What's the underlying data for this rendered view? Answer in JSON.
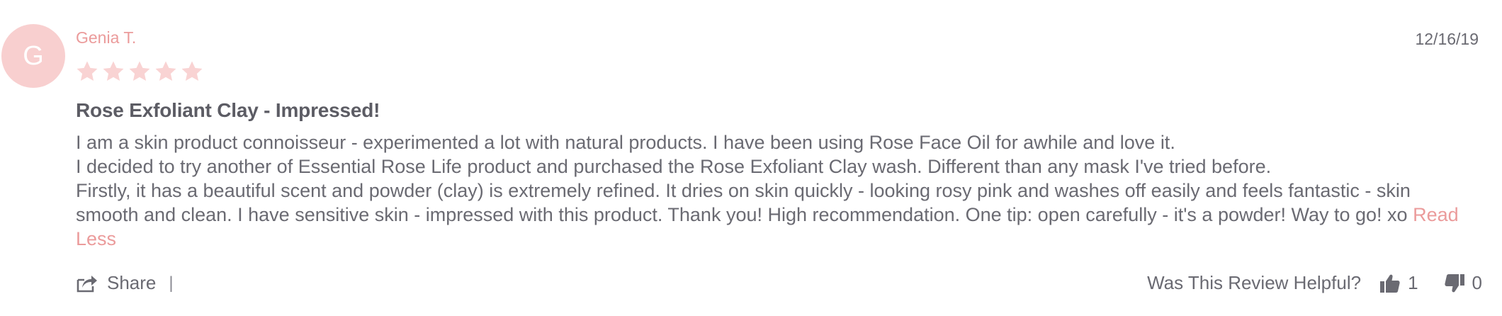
{
  "review": {
    "avatar_initial": "G",
    "author": "Genia T.",
    "date": "12/16/19",
    "rating": 5,
    "rating_max": 5,
    "title": "Rose Exfoliant Clay - Impressed!",
    "body_lines": [
      "I am a skin product connoisseur - experimented a lot with natural products. I have been using Rose Face Oil for awhile and love it.",
      "I decided to try another of Essential Rose Life product and purchased the Rose Exfoliant Clay wash. Different than any mask I've tried before.",
      "Firstly, it has a beautiful scent and powder (clay) is extremely refined. It dries on skin quickly - looking rosy pink and washes off easily and feels fantastic - skin smooth and clean. I have sensitive skin - impressed with this product. Thank you! High recommendation. One tip: open carefully - it's a powder! Way to go! xo"
    ],
    "read_less_label": "Read Less"
  },
  "footer": {
    "share_label": "Share",
    "divider": "|",
    "helpful_question": "Was This Review Helpful?",
    "thumbs_up_count": "1",
    "thumbs_down_count": "0"
  },
  "colors": {
    "accent": "#eb9b9b",
    "avatar_bg": "#f8cfcf",
    "star": "#f9d3d3",
    "text": "#6a6a72"
  },
  "icons": [
    "star-icon",
    "share-icon",
    "thumbs-up-icon",
    "thumbs-down-icon"
  ]
}
